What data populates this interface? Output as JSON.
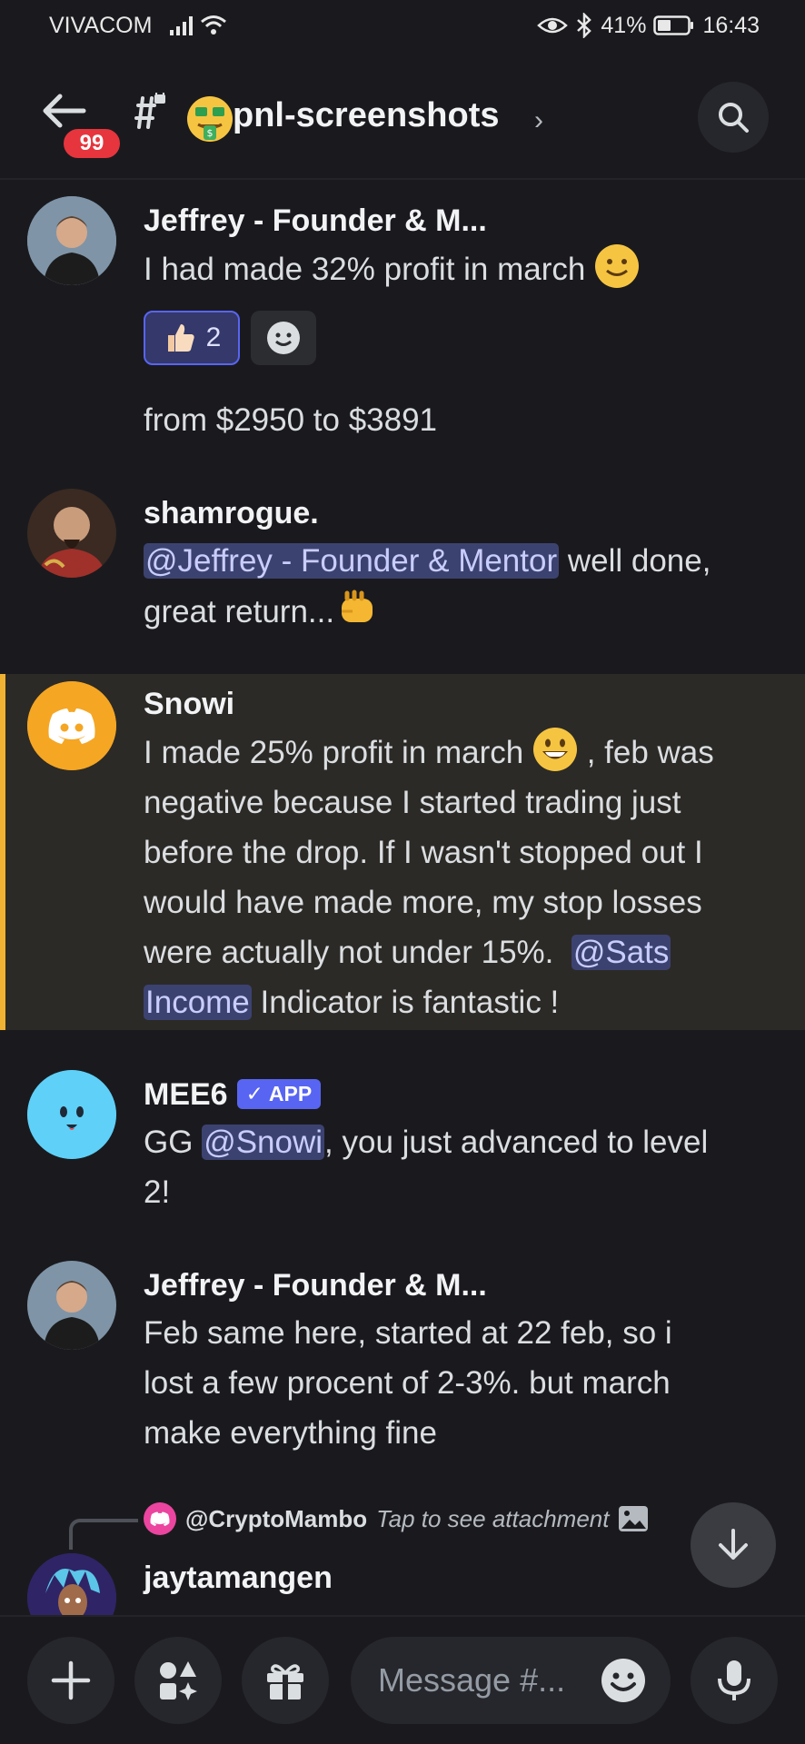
{
  "status": {
    "carrier": "VIVACOM",
    "battery": "41%",
    "time": "16:43"
  },
  "header": {
    "unread_badge": "99",
    "channel_name": "pnl-screenshots",
    "channel_emoji": "money-mouth-face",
    "chevron": "›"
  },
  "messages": [
    {
      "author": "Jeffrey - Founder & M...",
      "text": "I had made 32% profit in march",
      "reactions": [
        {
          "emoji": "thumbs-up",
          "count": "2"
        }
      ],
      "followup": "from $2950 to $3891"
    },
    {
      "author": "shamrogue.",
      "mention": "@Jeffrey - Founder & Mentor",
      "text_after": " well done,",
      "text_line2": "great return..."
    },
    {
      "author": "Snowi",
      "line1_before": "I made 25% profit in march ",
      "line1_after": " , feb was",
      "line2": "negative because I started trading just",
      "line3": "before the drop. If I wasn't stopped out I",
      "line4": "would have made more, my stop losses",
      "line5": "were actually not under 15%.  ",
      "mention_part1": "@Sats",
      "mention_part2": "Income",
      "line6_after": " Indicator is fantastic !"
    },
    {
      "author": "MEE6",
      "app_tag": "APP",
      "prefix": "GG ",
      "mention": "@Snowi",
      "suffix": ", you just advanced to level",
      "line2": "2!"
    },
    {
      "author": "Jeffrey - Founder & M...",
      "line1": "Feb same here, started at 22 feb, so i",
      "line2": "lost a few procent of 2-3%. but march",
      "line3": "make everything fine"
    },
    {
      "reply_user": "@CryptoMambo",
      "reply_text": "Tap to see attachment",
      "author": "jaytamangen"
    }
  ],
  "composer": {
    "placeholder": "Message #..."
  },
  "colors": {
    "accent": "#5865f2",
    "highlight_bar": "#f0b232",
    "badge": "#e6353d",
    "mention_bg": "#3c4270"
  }
}
